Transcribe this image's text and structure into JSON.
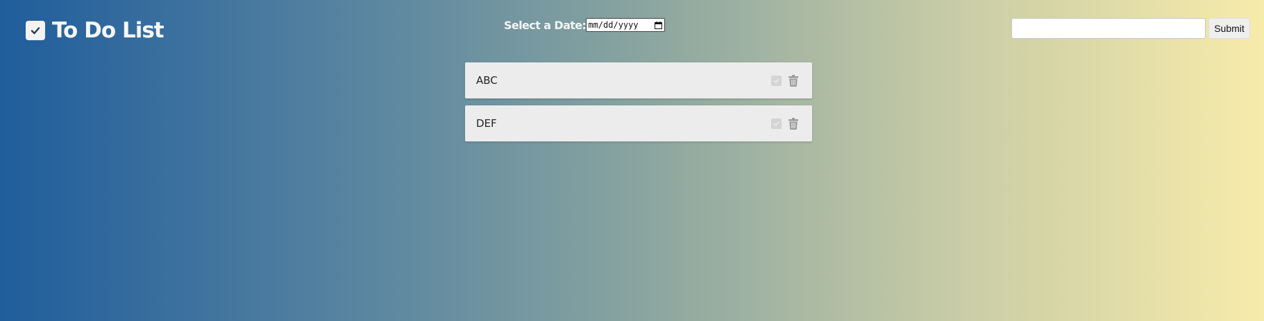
{
  "header": {
    "title": "To Do List",
    "logo_icon": "check-square-icon"
  },
  "date_picker": {
    "label": "Select a Date:",
    "value_placeholder": "mm/dd/yyyy",
    "icon": "calendar-icon"
  },
  "add_task": {
    "input_value": "",
    "submit_label": "Submit"
  },
  "tasks": [
    {
      "text": "ABC",
      "complete_icon": "check-square-icon",
      "delete_icon": "trash-icon"
    },
    {
      "text": "DEF",
      "complete_icon": "check-square-icon",
      "delete_icon": "trash-icon"
    }
  ],
  "colors": {
    "gradient_start": "#1f5d9c",
    "gradient_end": "#f7ebaa",
    "task_background": "#ececec",
    "icon_gray": "#9a9a9a"
  }
}
